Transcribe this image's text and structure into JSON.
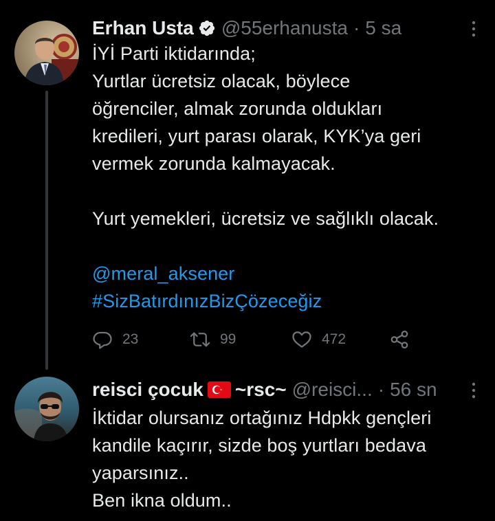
{
  "colors": {
    "background": "#000000",
    "text": "#e7e9ea",
    "muted": "#71767b",
    "link": "#1d9bf0",
    "thread_line": "#333639"
  },
  "tweets": [
    {
      "author": {
        "name": "Erhan Usta",
        "verified": true,
        "handle": "@55erhanusta",
        "avatar_icon": "profile-photo-man-in-suit"
      },
      "separator": "·",
      "time": "5 sa",
      "lines": [
        "İYİ Parti iktidarında;",
        "Yurtlar ücretsiz olacak, böylece",
        "öğrenciler, almak zorunda oldukları",
        "kredileri, yurt parası olarak, KYK’ya geri",
        "vermek zorunda kalmayacak.",
        "Yurt yemekleri, ücretsiz ve sağlıklı olacak."
      ],
      "mention": "@meral_aksener",
      "hashtag": "#SizBatırdınızBizÇözeceğiz",
      "stats": {
        "replies": "23",
        "retweets": "99",
        "likes": "472"
      }
    },
    {
      "author": {
        "name": "reisci çocuk",
        "flag_icon": "turkey-flag-icon",
        "name_suffix": "~rsc~",
        "handle": "@reisci...",
        "avatar_icon": "profile-photo-man-with-sunglasses"
      },
      "separator": "·",
      "time": "56 sn",
      "lines": [
        "İktidar olursanız ortağınız Hdpkk gençleri",
        "kandile kaçırır, sizde boş yurtları bedava",
        "yaparsınız..",
        "Ben ikna oldum.."
      ]
    }
  ]
}
